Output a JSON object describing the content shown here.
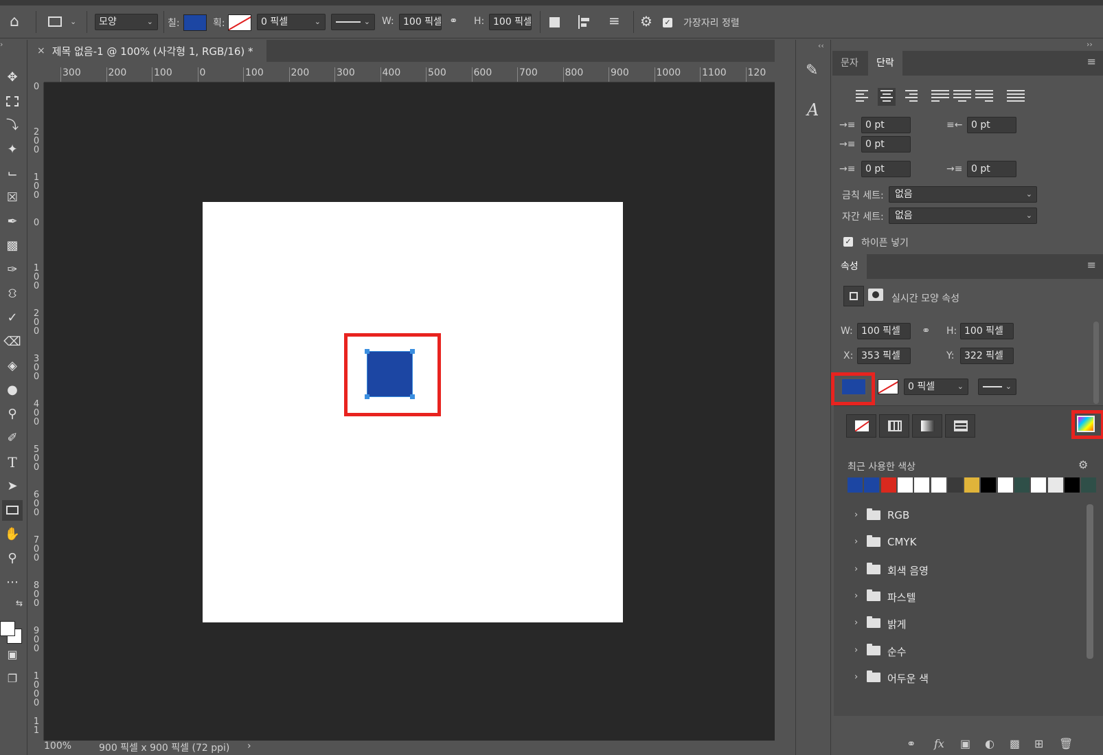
{
  "options_bar": {
    "mode_select": "모양",
    "fill_label": "칠:",
    "stroke_label": "획:",
    "stroke_width": "0 픽셀",
    "w_label": "W:",
    "w_value": "100 픽셀",
    "h_label": "H:",
    "h_value": "100 픽셀",
    "align_edges_label": "가장자리 정렬",
    "fill_color": "#1c46a3"
  },
  "document": {
    "tab_title": "제목 없음-1 @ 100% (사각형 1, RGB/16) *",
    "zoom": "100%",
    "status": "900 픽셀 x 900 픽셀 (72 ppi)",
    "ruler_h_labels": [
      "300",
      "200",
      "100",
      "0",
      "100",
      "200",
      "300",
      "400",
      "500",
      "600",
      "700",
      "800",
      "900",
      "1000",
      "1100",
      "120"
    ],
    "ruler_v_labels": [
      "0",
      "2\n0\n0",
      "1\n0\n0",
      "0",
      "1\n0\n0",
      "2\n0\n0",
      "3\n0\n0",
      "4\n0\n0",
      "5\n0\n0",
      "6\n0\n0",
      "7\n0\n0",
      "8\n0\n0",
      "9\n0\n0",
      "1\n0\n0\n0",
      "1\n1"
    ],
    "shape_color": "#1c46a3",
    "highlight_color": "#e8231f"
  },
  "paragraph_panel": {
    "tab_character": "문자",
    "tab_paragraph": "단락",
    "indent_left": "0 pt",
    "indent_right": "0 pt",
    "indent_first": "0 pt",
    "space_before": "0 pt",
    "space_after": "0 pt",
    "kinsoku_label": "금칙 세트:",
    "kinsoku_value": "없음",
    "mojikumi_label": "자간 세트:",
    "mojikumi_value": "없음",
    "hyphenate_label": "하이픈 넣기"
  },
  "properties_panel": {
    "tab_label": "속성",
    "live_shape_label": "실시간 모양 속성",
    "w_label": "W:",
    "w_value": "100 픽셀",
    "h_label": "H:",
    "h_value": "100 픽셀",
    "x_label": "X:",
    "x_value": "353 픽셀",
    "y_label": "Y:",
    "y_value": "322 픽셀",
    "stroke_width": "0 픽셀"
  },
  "swatch_popup": {
    "recent_label": "최근 사용한 색상",
    "recent_colors": [
      "#1c46a3",
      "#1c46a3",
      "#d9291e",
      "#ffffff",
      "#ffffff",
      "#ffffff",
      "#3a3a3a",
      "#e0b43a",
      "#000000",
      "#ffffff",
      "#2f4f48",
      "#ffffff",
      "#e8e8e8",
      "#000000",
      "#2f4f48"
    ],
    "folders": [
      "RGB",
      "CMYK",
      "회색 음영",
      "파스텔",
      "밝게",
      "순수",
      "어두운 색"
    ]
  }
}
